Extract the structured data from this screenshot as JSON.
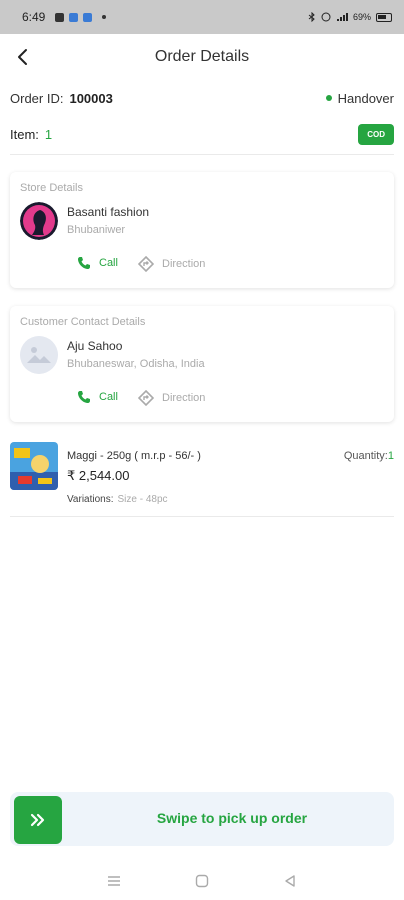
{
  "status_bar": {
    "time": "6:49",
    "battery": "69%"
  },
  "header": {
    "title": "Order Details"
  },
  "order": {
    "id_label": "Order ID:",
    "id_value": "100003",
    "status": "Handover",
    "item_label": "Item:",
    "item_count": "1",
    "payment_badge": "COD"
  },
  "store": {
    "section_title": "Store Details",
    "name": "Basanti fashion",
    "location": "Bhubaniwer",
    "call_label": "Call",
    "direction_label": "Direction"
  },
  "customer": {
    "section_title": "Customer Contact Details",
    "name": "Aju Sahoo",
    "address": "Bhubaneswar, Odisha, India",
    "call_label": "Call",
    "direction_label": "Direction"
  },
  "product": {
    "name": "Maggi - 250g ( m.r.p - 56/- )",
    "price": "₹ 2,544.00",
    "quantity_label": "Quantity:",
    "quantity_value": "1",
    "variations_label": "Variations:",
    "variations_value": "Size - 48pc"
  },
  "swipe": {
    "label": "Swipe to pick up order"
  },
  "colors": {
    "accent": "#26a541",
    "muted": "#aaaaaa",
    "swipe_bg": "#eef4fa"
  },
  "icons": {
    "back": "arrow-left-icon",
    "call": "phone-icon",
    "direction": "direction-icon",
    "swipe": "double-chevron-right-icon"
  }
}
